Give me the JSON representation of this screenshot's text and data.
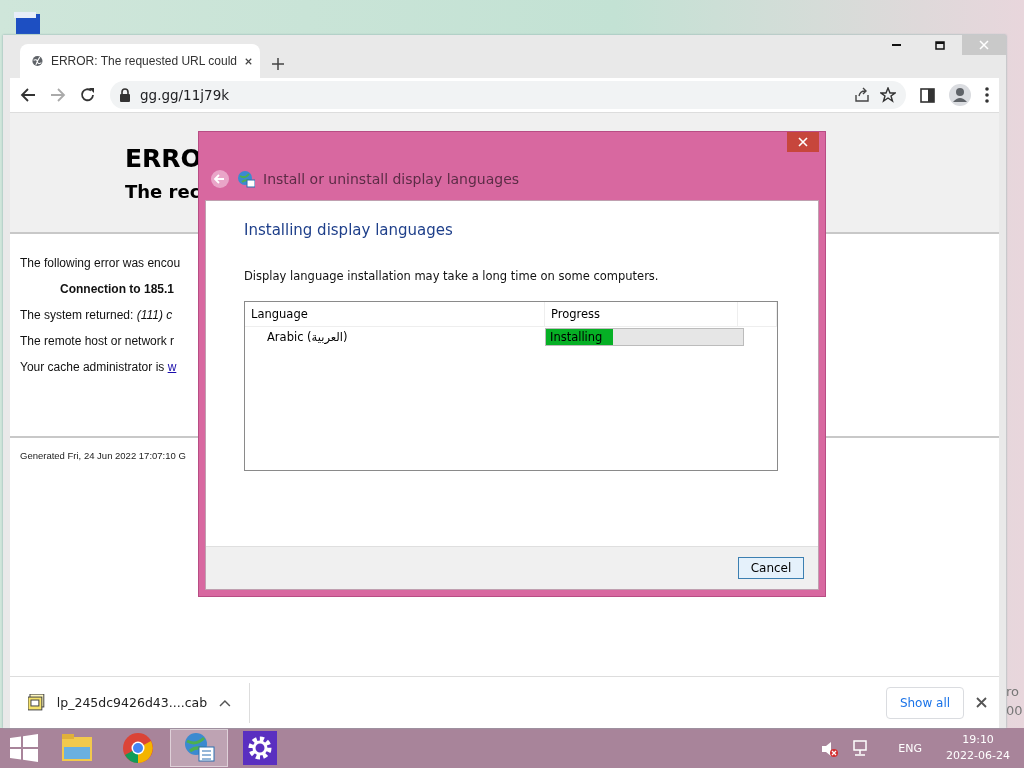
{
  "browser": {
    "tab": {
      "title": "ERROR: The requested URL could",
      "selected": true
    },
    "address": "gg.gg/11j79k",
    "page": {
      "heading": "ERRO",
      "subheading": "The rec",
      "paragraphs": [
        {
          "kind": "plain",
          "text": "The following error was encou"
        },
        {
          "kind": "bold",
          "text": "Connection to 185.1"
        },
        {
          "kind": "plain",
          "text": "The system returned: *(111) c*"
        },
        {
          "kind": "plain",
          "text": "The remote host or network r"
        },
        {
          "kind": "link",
          "text": "Your cache administrator is ",
          "link": "w"
        }
      ],
      "footer": "Generated Fri, 24 Jun 2022 17:07:10 G"
    },
    "download": {
      "file": "lp_245dc9426d43....cab",
      "show_all": "Show all"
    }
  },
  "dialog": {
    "title": "Install or uninstall display languages",
    "heading": "Installing display languages",
    "note": "Display language installation may take a long time on some computers.",
    "table": {
      "columns": [
        "Language",
        "Progress"
      ],
      "rows": [
        {
          "language": "Arabic (العربية)",
          "status": "Installing",
          "level": 0.34
        }
      ]
    },
    "cancel": "Cancel"
  },
  "desktop_edge_texts": [
    "ro",
    "00"
  ],
  "taskbar": {
    "apps": [
      {
        "kind": "folder",
        "active": false
      },
      {
        "kind": "chrome",
        "active": false
      },
      {
        "kind": "language",
        "active": true
      },
      {
        "kind": "settings",
        "active": false
      }
    ],
    "language": "ENG",
    "time": "19:10",
    "date": "2022-06-24"
  }
}
